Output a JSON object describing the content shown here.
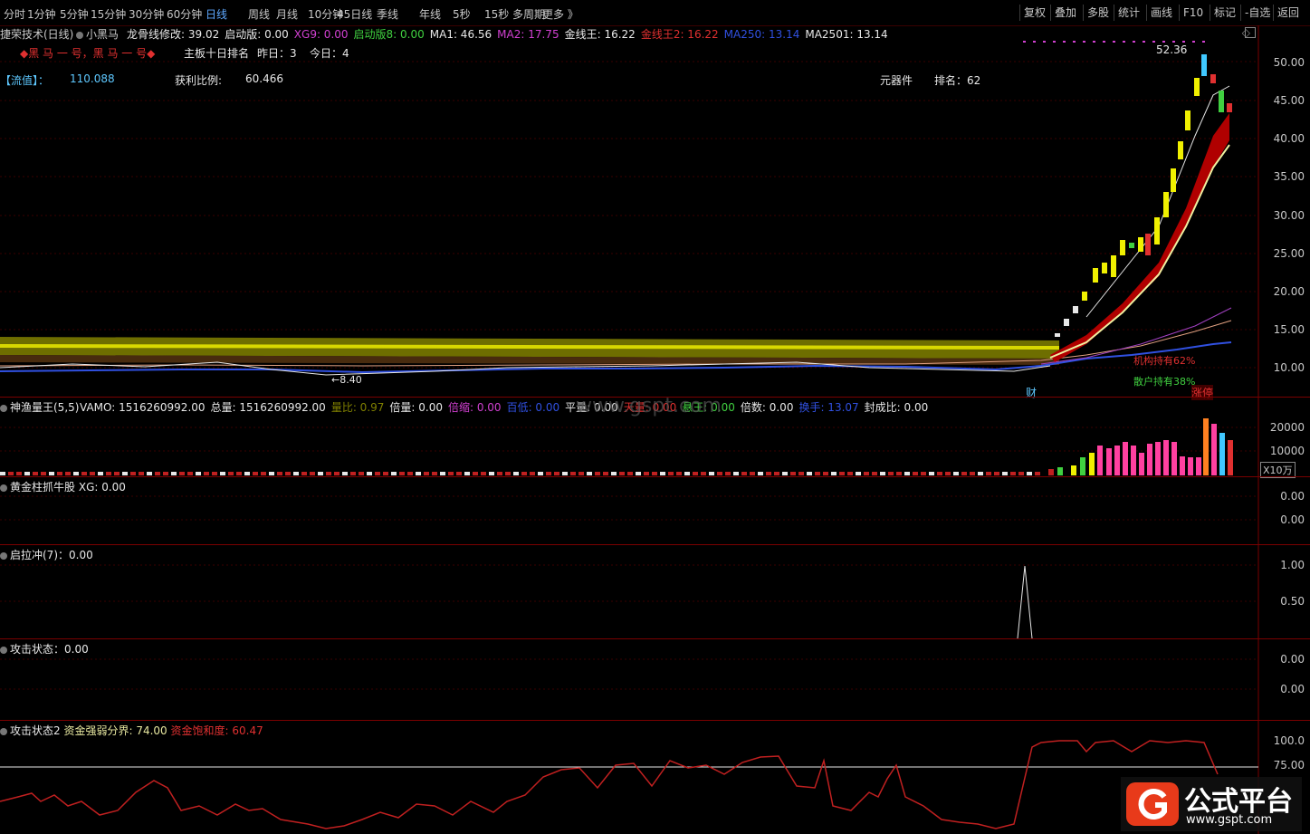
{
  "topbar": {
    "periods": [
      "分时",
      "1分钟",
      "5分钟",
      "15分钟",
      "30分钟",
      "60分钟",
      "日线",
      "周线",
      "月线",
      "10分钟",
      "45日线",
      "季线",
      "年线",
      "5秒",
      "15秒",
      "多周期",
      "更多 》"
    ],
    "active_period": "日线",
    "tools": [
      "复权",
      "叠加",
      "多股",
      "统计",
      "画线",
      "F10",
      "标记",
      "-自选",
      "返回"
    ]
  },
  "main_header": {
    "stock_name": "捷荣技术(日线)",
    "indicator": "小黑马",
    "items": [
      {
        "label": "龙骨线修改: 39.02",
        "color": "#e8e8e8"
      },
      {
        "label": "启动版: 0.00",
        "color": "#e8e8e8"
      },
      {
        "label": "XG9: 0.00",
        "color": "#d040d0"
      },
      {
        "label": "启动版8: 0.00",
        "color": "#40d040"
      },
      {
        "label": "MA1: 46.56",
        "color": "#e8e8e8"
      },
      {
        "label": "MA2: 17.75",
        "color": "#d040d0"
      },
      {
        "label": "金线王: 16.22",
        "color": "#e8e8e8"
      },
      {
        "label": "金线王2: 16.22",
        "color": "#e03030"
      },
      {
        "label": "MA250: 13.14",
        "color": "#3050e0"
      },
      {
        "label": "MA2501: 13.14",
        "color": "#e8e8e8"
      }
    ]
  },
  "main_info": {
    "tag": "◆黑 马 一 号，黑 马 一 号◆",
    "rank_title": "主板十日排名",
    "yesterday_label": "昨日：",
    "yesterday_value": "3",
    "today_label": "今日：",
    "today_value": "4",
    "float_label": "【流值】：",
    "float_value": "110.088",
    "profit_label": "获利比例:",
    "profit_value": "60.466",
    "sector": "元器件",
    "rank_label": "排名：",
    "rank_value": "62",
    "high_price": "52.36",
    "low_price": "8.40",
    "inst_text": "机构持有62%",
    "retail_text": "散户持有38%",
    "cai_label": "财",
    "limit_label": "涨停"
  },
  "price_axis": [
    "50.00",
    "45.00",
    "40.00",
    "35.00",
    "30.00",
    "25.00",
    "20.00",
    "15.00",
    "10.00"
  ],
  "vol_header": {
    "name": "神渔量王(5,5)",
    "items": [
      {
        "label": "VAMO: 1516260992.00",
        "color": "#e8e8e8"
      },
      {
        "label": "总量: 1516260992.00",
        "color": "#e8e8e8"
      },
      {
        "label": "量比: 0.97",
        "color": "#808000"
      },
      {
        "label": "倍量: 0.00",
        "color": "#e8e8e8"
      },
      {
        "label": "倍缩: 0.00",
        "color": "#d040d0"
      },
      {
        "label": "百低: 0.00",
        "color": "#3050e0"
      },
      {
        "label": "平量: 0.00",
        "color": "#e8e8e8"
      },
      {
        "label": "天量: 0.00",
        "color": "#e03030"
      },
      {
        "label": "悬王: 0.00",
        "color": "#40d040"
      },
      {
        "label": "倍数: 0.00",
        "color": "#e8e8e8"
      },
      {
        "label": "换手: 13.07",
        "color": "#3050e0"
      },
      {
        "label": "封成比: 0.00",
        "color": "#e8e8e8"
      }
    ],
    "watermark": "www.gspt.com"
  },
  "vol_axis": [
    "20000",
    "10000"
  ],
  "vol_unit": "X10万",
  "panel3": {
    "name": "黄金柱抓牛股",
    "item": "XG: 0.00",
    "axis": [
      "0.00",
      "0.00"
    ]
  },
  "panel4": {
    "name": "启拉冲(7)：0.00",
    "axis": [
      "1.00",
      "0.50"
    ]
  },
  "panel5": {
    "name": "攻击状态：0.00",
    "axis": [
      "0.00",
      "0.00"
    ]
  },
  "panel6": {
    "name": "攻击状态2",
    "item1": "资金强弱分界: 74.00",
    "item2": "资金饱和度: 60.47",
    "axis": [
      "100.0",
      "75.00"
    ]
  },
  "logo": {
    "title": "公式平台",
    "url": "www.gspt.com"
  }
}
